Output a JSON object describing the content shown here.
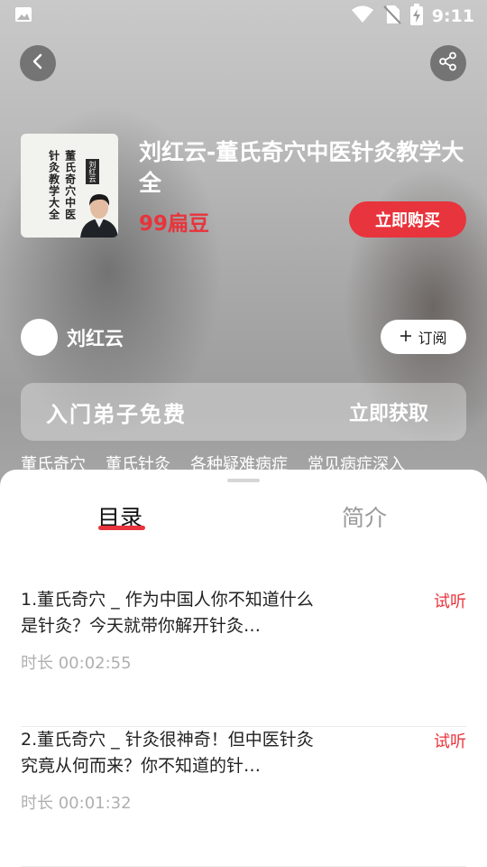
{
  "status_bar": {
    "time": "9:11",
    "icons": [
      "image-icon",
      "wifi-icon",
      "no-sim-icon",
      "battery-charging-icon"
    ]
  },
  "header": {
    "back_icon": "chevron-left-icon",
    "share_icon": "share-icon"
  },
  "course": {
    "cover_text": [
      "董氏奇穴中医",
      "针灸教学大全"
    ],
    "cover_badge": "刘红云",
    "title": "刘红云-董氏奇穴中医针灸教学大全",
    "price": "99扁豆",
    "buy_label": "立即购买"
  },
  "author": {
    "name": "刘红云",
    "subscribe_label": "订阅"
  },
  "promo": {
    "text": "入门弟子免费",
    "action": "立即获取"
  },
  "tags": [
    "董氏奇穴",
    "董氏针灸",
    "各种疑难病症",
    "常见病症深入"
  ],
  "tabs": [
    {
      "label": "目录",
      "active": true
    },
    {
      "label": "简介",
      "active": false
    }
  ],
  "lessons": [
    {
      "title": "1.董氏奇穴 _ 作为中国人你不知道什么是针灸？今天就带你解开针灸…",
      "trial": "试听",
      "duration": "时长 00:02:55"
    },
    {
      "title": "2.董氏奇穴 _ 针灸很神奇！但中医针灸究竟从何而来？你不知道的针…",
      "trial": "试听",
      "duration": "时长 00:01:32"
    }
  ],
  "colors": {
    "accent": "#e8343c",
    "muted": "#9a9a9a"
  }
}
